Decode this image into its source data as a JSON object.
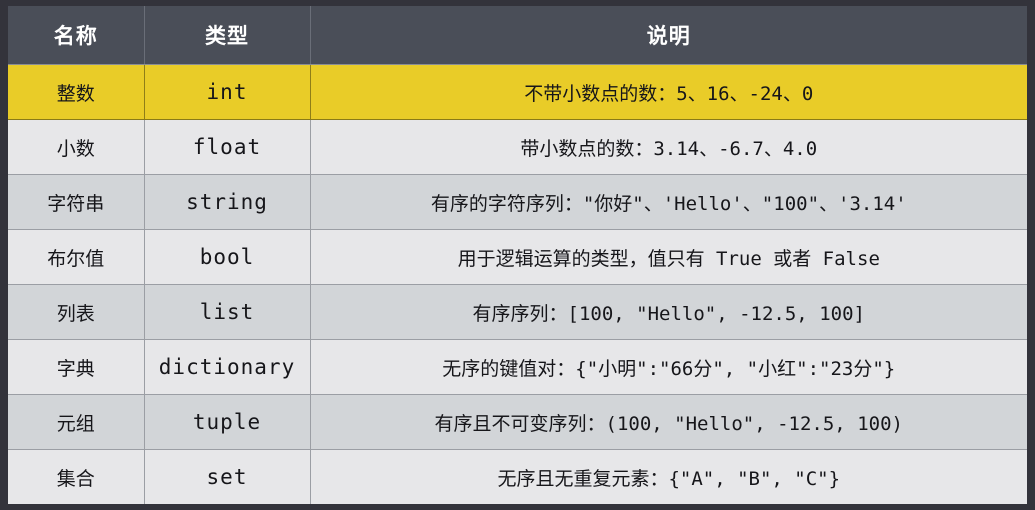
{
  "table": {
    "headers": {
      "name": "名称",
      "type": "类型",
      "description": "说明"
    },
    "colors": {
      "header_bg": "#4a4e58",
      "header_text": "#ffffff",
      "highlight_row_bg": "#e9cc28",
      "row_light_bg": "#e7e7e9",
      "row_dark_bg": "#d2d5d8",
      "frame_bg": "#33333b",
      "cell_text": "#16161a"
    },
    "rows": [
      {
        "name": "整数",
        "type": "int",
        "description": "不带小数点的数：5、16、-24、0",
        "style": "highlight"
      },
      {
        "name": "小数",
        "type": "float",
        "description": "带小数点的数：3.14、-6.7、4.0",
        "style": "light"
      },
      {
        "name": "字符串",
        "type": "string",
        "description": "有序的字符序列：\"你好\"、'Hello'、\"100\"、'3.14'",
        "style": "dark"
      },
      {
        "name": "布尔值",
        "type": "bool",
        "description": "用于逻辑运算的类型，值只有 True 或者 False",
        "style": "light"
      },
      {
        "name": "列表",
        "type": "list",
        "description": "有序序列：[100, \"Hello\", -12.5, 100]",
        "style": "dark"
      },
      {
        "name": "字典",
        "type": "dictionary",
        "description": "无序的键值对：{\"小明\":\"66分\", \"小红\":\"23分\"}",
        "style": "light"
      },
      {
        "name": "元组",
        "type": "tuple",
        "description": "有序且不可变序列：(100, \"Hello\", -12.5, 100)",
        "style": "dark"
      },
      {
        "name": "集合",
        "type": "set",
        "description": "无序且无重复元素：{\"A\", \"B\", \"C\"}",
        "style": "light"
      }
    ]
  }
}
